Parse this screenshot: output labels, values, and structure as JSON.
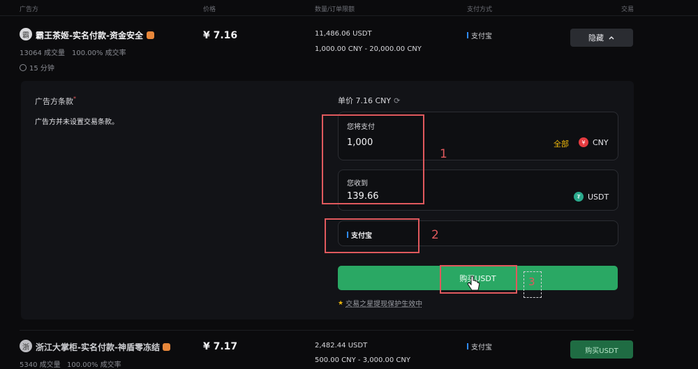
{
  "header": {
    "col_advertiser": "广告方",
    "col_price": "价格",
    "col_quantity": "数量/订单限额",
    "col_payment": "支付方式",
    "col_trade": "交易"
  },
  "listing1": {
    "avatar_initial": "霸",
    "merchant_name": "霸王茶姬-实名付款-资金安全",
    "trades": "13064 成交量",
    "completion": "100.00% 成交率",
    "time": "15 分钟",
    "price": "¥ 7.16",
    "quantity": "11,486.06 USDT",
    "limit": "1,000.00 CNY - 20,000.00 CNY",
    "payment": "支付宝",
    "hide_label": "隐藏",
    "hide_icon": "chevron-up-icon"
  },
  "panel": {
    "terms_title": "广告方条款",
    "required_mark": "*",
    "terms_text": "广告方并未设置交易条款。",
    "unit_price": "单价 7.16 CNY",
    "pay_label": "您将支付",
    "pay_value": "1,000",
    "all_label": "全部",
    "pay_currency": "CNY",
    "receive_label": "您收到",
    "receive_value": "139.66",
    "receive_currency": "USDT",
    "payment_method": "支付宝",
    "buy_label": "购买USDT",
    "protection_text": "交易之星提现保护生效中"
  },
  "annotations": {
    "label1": "1",
    "label2": "2",
    "label3": "3"
  },
  "listing2": {
    "avatar_initial": "浙",
    "merchant_name": "浙江大掌柜-实名付款-神盾零冻结",
    "trades": "5340 成交量",
    "completion": "100.00% 成交率",
    "price": "¥ 7.17",
    "quantity": "2,482.44 USDT",
    "limit": "500.00 CNY - 3,000.00 CNY",
    "payment": "支付宝",
    "buy_label": "购买USDT"
  },
  "colors": {
    "accent_green": "#2aa864",
    "annotation_red": "#e0595d",
    "gold": "#f0b90b"
  }
}
